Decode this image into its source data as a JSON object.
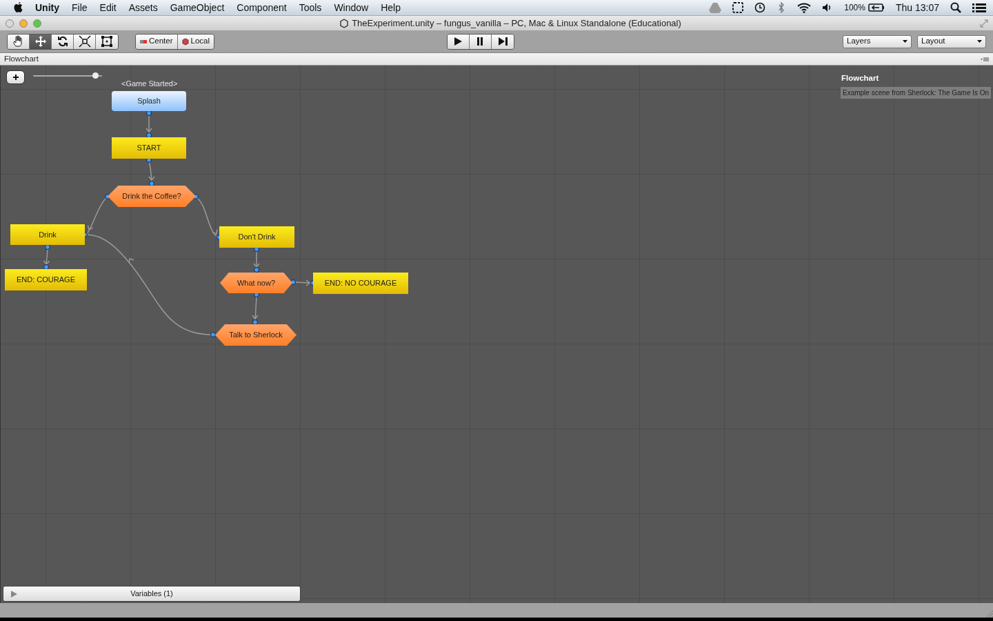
{
  "menu_bar": {
    "app": "Unity",
    "menus": [
      "File",
      "Edit",
      "Assets",
      "GameObject",
      "Component",
      "Tools",
      "Window",
      "Help"
    ],
    "battery": "100%",
    "clock": "Thu 13:07"
  },
  "window": {
    "title": "TheExperiment.unity – fungus_vanilla – PC, Mac & Linux Standalone (Educational)"
  },
  "toolbar": {
    "tools": [
      {
        "kind": "hand",
        "selected": false
      },
      {
        "kind": "move",
        "selected": true
      },
      {
        "kind": "rotate",
        "selected": false
      },
      {
        "kind": "scale",
        "selected": false
      },
      {
        "kind": "rect",
        "selected": false
      }
    ],
    "pivot_buttons": [
      {
        "kind": "pivot",
        "label": "Center"
      },
      {
        "kind": "space",
        "label": "Local"
      }
    ],
    "dropdowns": [
      "Layers",
      "Layout"
    ]
  },
  "panel": {
    "tab": "Flowchart"
  },
  "flowchart": {
    "zoom": {
      "level": 0.91
    },
    "event_label": "<Game Started>",
    "nodes": [
      {
        "label": "Splash",
        "kind": "event"
      },
      {
        "label": "START",
        "kind": "block"
      },
      {
        "label": "Drink the Coffee?",
        "kind": "choice"
      },
      {
        "label": "Drink",
        "kind": "block"
      },
      {
        "label": "Don't Drink",
        "kind": "block"
      },
      {
        "label": "END: COURAGE",
        "kind": "block"
      },
      {
        "label": "What now?",
        "kind": "choice"
      },
      {
        "label": "END: NO COURAGE",
        "kind": "block"
      },
      {
        "label": "Talk to Sherlock",
        "kind": "choice"
      }
    ],
    "info": {
      "title": "Flowchart",
      "description": "Example scene from Sherlock: The Game Is On"
    },
    "variables": {
      "label": "Variables (1)",
      "expanded": false
    }
  }
}
